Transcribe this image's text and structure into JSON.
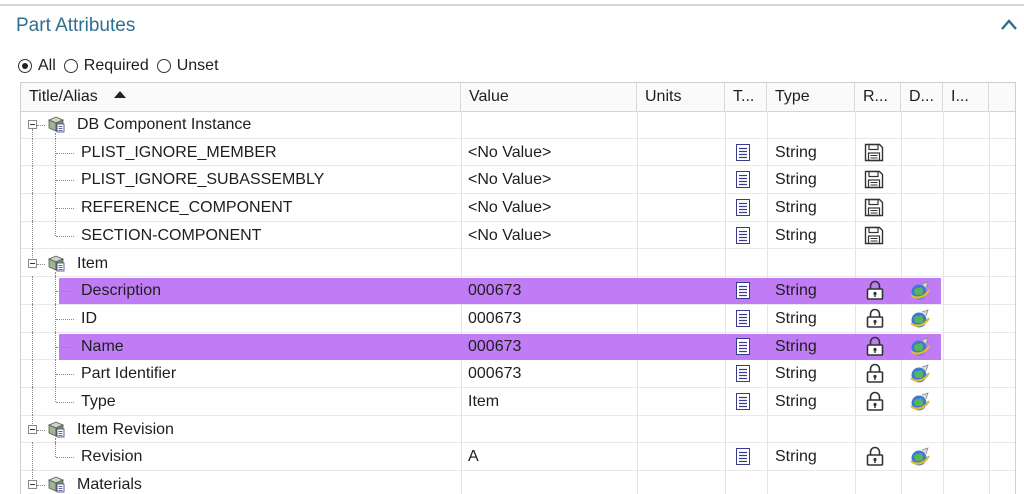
{
  "panel": {
    "title": "Part Attributes"
  },
  "filters": [
    {
      "label": "All",
      "checked": true
    },
    {
      "label": "Required",
      "checked": false
    },
    {
      "label": "Unset",
      "checked": false
    }
  ],
  "columns": [
    {
      "label": "Title/Alias",
      "sorted": "asc"
    },
    {
      "label": "Value"
    },
    {
      "label": "Units"
    },
    {
      "label": "T..."
    },
    {
      "label": "Type"
    },
    {
      "label": "R..."
    },
    {
      "label": "D..."
    },
    {
      "label": "I..."
    }
  ],
  "rows": [
    {
      "kind": "group",
      "title": "DB Component Instance"
    },
    {
      "kind": "attr",
      "title": "PLIST_IGNORE_MEMBER",
      "value": "<No Value>",
      "type": "String",
      "r_icon": "save-disk-icon",
      "d_icon": "",
      "highlighted": false
    },
    {
      "kind": "attr",
      "title": "PLIST_IGNORE_SUBASSEMBLY",
      "value": "<No Value>",
      "type": "String",
      "r_icon": "save-disk-icon",
      "d_icon": "",
      "highlighted": false
    },
    {
      "kind": "attr",
      "title": "REFERENCE_COMPONENT",
      "value": "<No Value>",
      "type": "String",
      "r_icon": "save-disk-icon",
      "d_icon": "",
      "highlighted": false
    },
    {
      "kind": "attr",
      "title": "SECTION-COMPONENT",
      "value": "<No Value>",
      "type": "String",
      "r_icon": "save-disk-icon",
      "d_icon": "",
      "highlighted": false
    },
    {
      "kind": "group",
      "title": "Item"
    },
    {
      "kind": "attr",
      "title": "Description",
      "value": "000673",
      "type": "String",
      "r_icon": "lock-icon",
      "d_icon": "globe-icon",
      "highlighted": true
    },
    {
      "kind": "attr",
      "title": "ID",
      "value": "000673",
      "type": "String",
      "r_icon": "lock-icon",
      "d_icon": "globe-icon",
      "highlighted": false
    },
    {
      "kind": "attr",
      "title": "Name",
      "value": "000673",
      "type": "String",
      "r_icon": "lock-icon",
      "d_icon": "globe-icon",
      "highlighted": true
    },
    {
      "kind": "attr",
      "title": "Part Identifier",
      "value": "000673",
      "type": "String",
      "r_icon": "lock-icon",
      "d_icon": "globe-icon",
      "highlighted": false
    },
    {
      "kind": "attr",
      "title": "Type",
      "value": "Item",
      "type": "String",
      "r_icon": "lock-icon",
      "d_icon": "globe-icon",
      "highlighted": false
    },
    {
      "kind": "group",
      "title": "Item Revision"
    },
    {
      "kind": "attr",
      "title": "Revision",
      "value": "A",
      "type": "String",
      "r_icon": "lock-icon",
      "d_icon": "globe-icon",
      "highlighted": false
    },
    {
      "kind": "group",
      "title": "Materials"
    }
  ],
  "colors": {
    "accent_title": "#2e6f8e",
    "highlight": "#c07cf5"
  }
}
